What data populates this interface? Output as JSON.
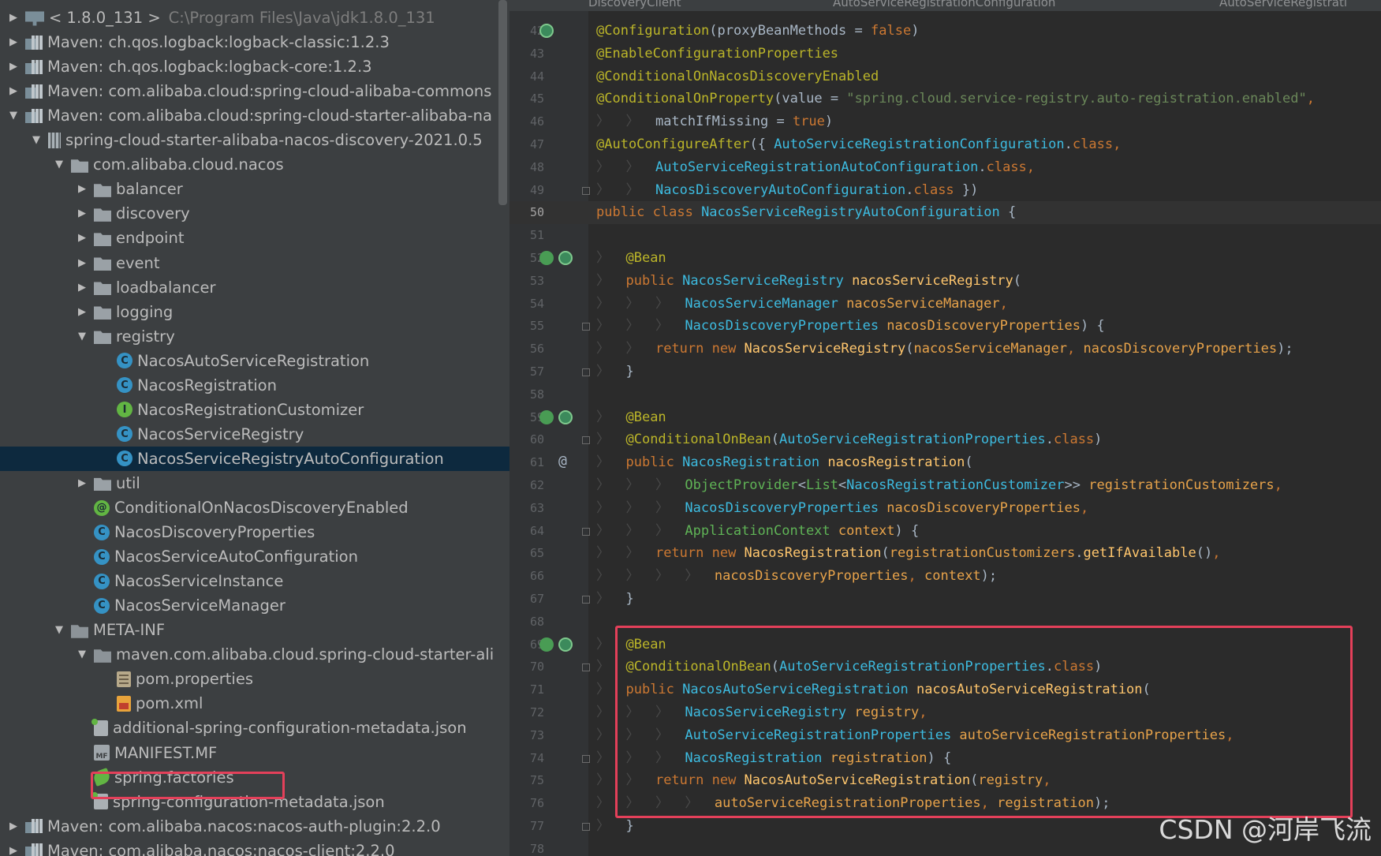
{
  "tree": {
    "rows": [
      {
        "arrow": "▶",
        "indent": 0,
        "icon": "sdk-icon",
        "iconclass": "sdk",
        "label": "< 1.8.0_131 >",
        "sub": "C:\\Program Files\\Java\\jdk1.8.0_131"
      },
      {
        "arrow": "▶",
        "indent": 0,
        "icon": "library-icon",
        "iconclass": "lib",
        "label": "Maven: ch.qos.logback:logback-classic:1.2.3"
      },
      {
        "arrow": "▶",
        "indent": 0,
        "icon": "library-icon",
        "iconclass": "lib",
        "label": "Maven: ch.qos.logback:logback-core:1.2.3"
      },
      {
        "arrow": "▶",
        "indent": 0,
        "icon": "library-icon",
        "iconclass": "lib",
        "label": "Maven: com.alibaba.cloud:spring-cloud-alibaba-commons"
      },
      {
        "arrow": "▼",
        "indent": 0,
        "icon": "library-icon",
        "iconclass": "lib",
        "label": "Maven: com.alibaba.cloud:spring-cloud-starter-alibaba-na"
      },
      {
        "arrow": "▼",
        "indent": 1,
        "icon": "jar-icon",
        "iconclass": "jar",
        "label": "spring-cloud-starter-alibaba-nacos-discovery-2021.0.5"
      },
      {
        "arrow": "▼",
        "indent": 2,
        "icon": "package-icon",
        "iconclass": "pkg",
        "label": "com.alibaba.cloud.nacos"
      },
      {
        "arrow": "▶",
        "indent": 3,
        "icon": "package-icon",
        "iconclass": "pkg",
        "label": "balancer"
      },
      {
        "arrow": "▶",
        "indent": 3,
        "icon": "package-icon",
        "iconclass": "pkg",
        "label": "discovery"
      },
      {
        "arrow": "▶",
        "indent": 3,
        "icon": "package-icon",
        "iconclass": "pkg",
        "label": "endpoint"
      },
      {
        "arrow": "▶",
        "indent": 3,
        "icon": "package-icon",
        "iconclass": "pkg",
        "label": "event"
      },
      {
        "arrow": "▶",
        "indent": 3,
        "icon": "package-icon",
        "iconclass": "pkg",
        "label": "loadbalancer"
      },
      {
        "arrow": "▶",
        "indent": 3,
        "icon": "package-icon",
        "iconclass": "pkg",
        "label": "logging"
      },
      {
        "arrow": "▼",
        "indent": 3,
        "icon": "package-icon",
        "iconclass": "pkg",
        "label": "registry"
      },
      {
        "arrow": "",
        "indent": 4,
        "icon": "class-icon",
        "iconclass": "cls",
        "glyph": "C",
        "label": "NacosAutoServiceRegistration"
      },
      {
        "arrow": "",
        "indent": 4,
        "icon": "class-icon",
        "iconclass": "cls",
        "glyph": "C",
        "label": "NacosRegistration"
      },
      {
        "arrow": "",
        "indent": 4,
        "icon": "interface-icon",
        "iconclass": "intf",
        "glyph": "I",
        "label": "NacosRegistrationCustomizer"
      },
      {
        "arrow": "",
        "indent": 4,
        "icon": "class-icon",
        "iconclass": "cls",
        "glyph": "C",
        "label": "NacosServiceRegistry"
      },
      {
        "arrow": "",
        "indent": 4,
        "icon": "class-icon",
        "iconclass": "cls",
        "glyph": "C",
        "label": "NacosServiceRegistryAutoConfiguration",
        "selected": true
      },
      {
        "arrow": "▶",
        "indent": 3,
        "icon": "package-icon",
        "iconclass": "pkg",
        "label": "util"
      },
      {
        "arrow": "",
        "indent": 3,
        "icon": "annotation-icon",
        "iconclass": "anno",
        "glyph": "@",
        "label": "ConditionalOnNacosDiscoveryEnabled"
      },
      {
        "arrow": "",
        "indent": 3,
        "icon": "class-icon",
        "iconclass": "cls",
        "glyph": "C",
        "label": "NacosDiscoveryProperties"
      },
      {
        "arrow": "",
        "indent": 3,
        "icon": "class-icon",
        "iconclass": "cls",
        "glyph": "C",
        "label": "NacosServiceAutoConfiguration"
      },
      {
        "arrow": "",
        "indent": 3,
        "icon": "class-icon",
        "iconclass": "cls",
        "glyph": "C",
        "label": "NacosServiceInstance"
      },
      {
        "arrow": "",
        "indent": 3,
        "icon": "class-icon",
        "iconclass": "cls",
        "glyph": "C",
        "label": "NacosServiceManager"
      },
      {
        "arrow": "▼",
        "indent": 2,
        "icon": "folder-icon",
        "iconclass": "folder",
        "label": "META-INF"
      },
      {
        "arrow": "▼",
        "indent": 3,
        "icon": "folder-icon",
        "iconclass": "folder",
        "label": "maven.com.alibaba.cloud.spring-cloud-starter-ali"
      },
      {
        "arrow": "",
        "indent": 4,
        "icon": "properties-file-icon",
        "iconclass": "props",
        "label": "pom.properties"
      },
      {
        "arrow": "",
        "indent": 4,
        "icon": "xml-file-icon",
        "iconclass": "xmlf",
        "label": "pom.xml"
      },
      {
        "arrow": "",
        "indent": 3,
        "icon": "json-file-icon",
        "iconclass": "jsonf",
        "label": "additional-spring-configuration-metadata.json"
      },
      {
        "arrow": "",
        "indent": 3,
        "icon": "manifest-file-icon",
        "iconclass": "mff",
        "glyph": "MF",
        "label": "MANIFEST.MF"
      },
      {
        "arrow": "",
        "indent": 3,
        "icon": "spring-file-icon",
        "iconclass": "springf",
        "label": "spring.factories",
        "highlight": true
      },
      {
        "arrow": "",
        "indent": 3,
        "icon": "json-file-icon",
        "iconclass": "jsonf",
        "label": "spring-configuration-metadata.json"
      },
      {
        "arrow": "▶",
        "indent": 0,
        "icon": "library-icon",
        "iconclass": "lib",
        "label": "Maven: com.alibaba.nacos:nacos-auth-plugin:2.2.0"
      },
      {
        "arrow": "▶",
        "indent": 0,
        "icon": "library-icon",
        "iconclass": "lib",
        "label": "Maven: com.alibaba.nacos:nacos-client:2.2.0"
      }
    ]
  },
  "editor": {
    "tabs": [
      "DiscoveryClient",
      "AutoServiceRegistrationConfiguration",
      "AutoServiceRegistrati"
    ],
    "current_line": 50,
    "lines": [
      {
        "n": 42,
        "gutter": "impl",
        "segs": [
          [
            "ann",
            "@Configuration"
          ],
          [
            "plain",
            "(proxyBeanMethods = "
          ],
          [
            "kw",
            "false"
          ],
          [
            "plain",
            ")"
          ]
        ]
      },
      {
        "n": 43,
        "segs": [
          [
            "ann",
            "@EnableConfigurationProperties"
          ]
        ]
      },
      {
        "n": 44,
        "segs": [
          [
            "ann",
            "@ConditionalOnNacosDiscoveryEnabled"
          ]
        ]
      },
      {
        "n": 45,
        "segs": [
          [
            "ann",
            "@ConditionalOnProperty"
          ],
          [
            "plain",
            "(value = "
          ],
          [
            "str",
            "\"spring.cloud.service-registry.auto-registration.enabled\""
          ],
          [
            "kw",
            ","
          ]
        ]
      },
      {
        "n": 46,
        "segs": [
          [
            "indent",
            "〉  〉  "
          ],
          [
            "plain",
            "matchIfMissing = "
          ],
          [
            "kw",
            "true"
          ],
          [
            "plain",
            ")"
          ]
        ]
      },
      {
        "n": 47,
        "segs": [
          [
            "ann",
            "@AutoConfigureAfter"
          ],
          [
            "plain",
            "({ "
          ],
          [
            "ty",
            "AutoServiceRegistrationConfiguration"
          ],
          [
            "plain",
            "."
          ],
          [
            "kw",
            "class"
          ],
          [
            "kw",
            ","
          ]
        ]
      },
      {
        "n": 48,
        "segs": [
          [
            "indent",
            "〉  〉  "
          ],
          [
            "ty",
            "AutoServiceRegistrationAutoConfiguration"
          ],
          [
            "plain",
            "."
          ],
          [
            "kw",
            "class"
          ],
          [
            "kw",
            ","
          ]
        ]
      },
      {
        "n": 49,
        "fold": true,
        "segs": [
          [
            "indent",
            "〉  〉  "
          ],
          [
            "ty",
            "NacosDiscoveryAutoConfiguration"
          ],
          [
            "plain",
            "."
          ],
          [
            "kw",
            "class"
          ],
          [
            "plain",
            " })"
          ]
        ]
      },
      {
        "n": 50,
        "segs": [
          [
            "kw",
            "public class "
          ],
          [
            "ty",
            "NacosServiceRegistryAutoConfiguration"
          ],
          [
            "plain",
            " {"
          ]
        ]
      },
      {
        "n": 51,
        "segs": []
      },
      {
        "n": 52,
        "gutter": "run-impl",
        "segs": [
          [
            "indent",
            "〉  "
          ],
          [
            "ann",
            "@Bean"
          ]
        ]
      },
      {
        "n": 53,
        "segs": [
          [
            "indent",
            "〉  "
          ],
          [
            "kw",
            "public "
          ],
          [
            "ty",
            "NacosServiceRegistry "
          ],
          [
            "mth",
            "nacosServiceRegistry"
          ],
          [
            "plain",
            "("
          ]
        ]
      },
      {
        "n": 54,
        "segs": [
          [
            "indent",
            "〉  〉  〉  "
          ],
          [
            "ty",
            "NacosServiceManager "
          ],
          [
            "par",
            "nacosServiceManager"
          ],
          [
            "kw",
            ","
          ]
        ]
      },
      {
        "n": 55,
        "fold": true,
        "segs": [
          [
            "indent",
            "〉  〉  〉  "
          ],
          [
            "ty",
            "NacosDiscoveryProperties "
          ],
          [
            "par",
            "nacosDiscoveryProperties"
          ],
          [
            "plain",
            ") {"
          ]
        ]
      },
      {
        "n": 56,
        "segs": [
          [
            "indent",
            "〉  〉  "
          ],
          [
            "kw",
            "return new "
          ],
          [
            "mth",
            "NacosServiceRegistry"
          ],
          [
            "plain",
            "("
          ],
          [
            "par",
            "nacosServiceManager"
          ],
          [
            "kw",
            ", "
          ],
          [
            "par",
            "nacosDiscoveryProperties"
          ],
          [
            "plain",
            ");"
          ]
        ]
      },
      {
        "n": 57,
        "fold": true,
        "segs": [
          [
            "indent",
            "〉  "
          ],
          [
            "plain",
            "}"
          ]
        ]
      },
      {
        "n": 58,
        "segs": []
      },
      {
        "n": 59,
        "gutter": "run-impl",
        "segs": [
          [
            "indent",
            "〉  "
          ],
          [
            "ann",
            "@Bean"
          ]
        ]
      },
      {
        "n": 60,
        "fold": true,
        "segs": [
          [
            "indent",
            "〉  "
          ],
          [
            "ann",
            "@ConditionalOnBean"
          ],
          [
            "plain",
            "("
          ],
          [
            "ty",
            "AutoServiceRegistrationProperties"
          ],
          [
            "plain",
            "."
          ],
          [
            "kw",
            "class"
          ],
          [
            "plain",
            ")"
          ]
        ]
      },
      {
        "n": 61,
        "gutter": "at",
        "segs": [
          [
            "indent",
            "〉  "
          ],
          [
            "kw",
            "public "
          ],
          [
            "ty",
            "NacosRegistration "
          ],
          [
            "mth",
            "nacosRegistration"
          ],
          [
            "plain",
            "("
          ]
        ]
      },
      {
        "n": 62,
        "segs": [
          [
            "indent",
            "〉  〉  〉  "
          ],
          [
            "gn",
            "ObjectProvider"
          ],
          [
            "plain",
            "<"
          ],
          [
            "gn",
            "List"
          ],
          [
            "plain",
            "<"
          ],
          [
            "ty",
            "NacosRegistrationCustomizer"
          ],
          [
            "plain",
            ">> "
          ],
          [
            "par",
            "registrationCustomizers"
          ],
          [
            "kw",
            ","
          ]
        ]
      },
      {
        "n": 63,
        "segs": [
          [
            "indent",
            "〉  〉  〉  "
          ],
          [
            "ty",
            "NacosDiscoveryProperties "
          ],
          [
            "par",
            "nacosDiscoveryProperties"
          ],
          [
            "kw",
            ","
          ]
        ]
      },
      {
        "n": 64,
        "fold": true,
        "segs": [
          [
            "indent",
            "〉  〉  〉  "
          ],
          [
            "gn",
            "ApplicationContext "
          ],
          [
            "par",
            "context"
          ],
          [
            "plain",
            ") {"
          ]
        ]
      },
      {
        "n": 65,
        "segs": [
          [
            "indent",
            "〉  〉  "
          ],
          [
            "kw",
            "return new "
          ],
          [
            "mth",
            "NacosRegistration"
          ],
          [
            "plain",
            "("
          ],
          [
            "par",
            "registrationCustomizers"
          ],
          [
            "plain",
            "."
          ],
          [
            "mth",
            "getIfAvailable"
          ],
          [
            "plain",
            "()"
          ],
          [
            "kw",
            ","
          ]
        ]
      },
      {
        "n": 66,
        "segs": [
          [
            "indent",
            "〉  〉  〉  〉  "
          ],
          [
            "par",
            "nacosDiscoveryProperties"
          ],
          [
            "kw",
            ", "
          ],
          [
            "par",
            "context"
          ],
          [
            "plain",
            ");"
          ]
        ]
      },
      {
        "n": 67,
        "fold": true,
        "segs": [
          [
            "indent",
            "〉  "
          ],
          [
            "plain",
            "}"
          ]
        ]
      },
      {
        "n": 68,
        "segs": []
      },
      {
        "n": 69,
        "gutter": "run-impl",
        "segs": [
          [
            "indent",
            "〉  "
          ],
          [
            "ann",
            "@Bean"
          ]
        ]
      },
      {
        "n": 70,
        "fold": true,
        "segs": [
          [
            "indent",
            "〉  "
          ],
          [
            "ann",
            "@ConditionalOnBean"
          ],
          [
            "plain",
            "("
          ],
          [
            "ty",
            "AutoServiceRegistrationProperties"
          ],
          [
            "plain",
            "."
          ],
          [
            "kw",
            "class"
          ],
          [
            "plain",
            ")"
          ]
        ]
      },
      {
        "n": 71,
        "segs": [
          [
            "indent",
            "〉  "
          ],
          [
            "kw",
            "public "
          ],
          [
            "ty",
            "NacosAutoServiceRegistration "
          ],
          [
            "mth",
            "nacosAutoServiceRegistration"
          ],
          [
            "plain",
            "("
          ]
        ]
      },
      {
        "n": 72,
        "segs": [
          [
            "indent",
            "〉  〉  〉  "
          ],
          [
            "ty",
            "NacosServiceRegistry "
          ],
          [
            "par",
            "registry"
          ],
          [
            "kw",
            ","
          ]
        ]
      },
      {
        "n": 73,
        "segs": [
          [
            "indent",
            "〉  〉  〉  "
          ],
          [
            "ty",
            "AutoServiceRegistrationProperties "
          ],
          [
            "par",
            "autoServiceRegistrationProperties"
          ],
          [
            "kw",
            ","
          ]
        ]
      },
      {
        "n": 74,
        "fold": true,
        "segs": [
          [
            "indent",
            "〉  〉  〉  "
          ],
          [
            "ty",
            "NacosRegistration "
          ],
          [
            "par",
            "registration"
          ],
          [
            "plain",
            ") {"
          ]
        ]
      },
      {
        "n": 75,
        "segs": [
          [
            "indent",
            "〉  〉  "
          ],
          [
            "kw",
            "return new "
          ],
          [
            "mth",
            "NacosAutoServiceRegistration"
          ],
          [
            "plain",
            "("
          ],
          [
            "par",
            "registry"
          ],
          [
            "kw",
            ","
          ]
        ]
      },
      {
        "n": 76,
        "segs": [
          [
            "indent",
            "〉  〉  〉  〉  "
          ],
          [
            "par",
            "autoServiceRegistrationProperties"
          ],
          [
            "kw",
            ", "
          ],
          [
            "par",
            "registration"
          ],
          [
            "plain",
            ");"
          ]
        ]
      },
      {
        "n": 77,
        "fold": true,
        "segs": [
          [
            "indent",
            "〉  "
          ],
          [
            "plain",
            "}"
          ]
        ]
      },
      {
        "n": 78,
        "segs": []
      }
    ]
  },
  "watermark": "CSDN @河岸飞流",
  "colors": {
    "highlight_box": "#e4405a",
    "selection": "#0d293e",
    "tree_bg": "#3c3f41",
    "editor_bg": "#2b2b2b"
  }
}
